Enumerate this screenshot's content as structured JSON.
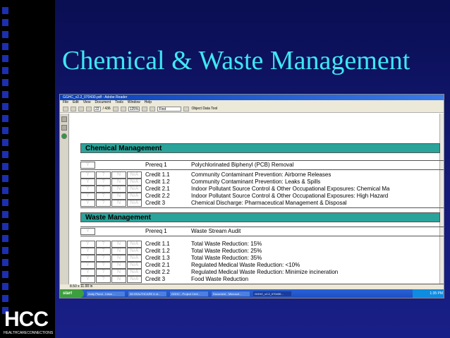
{
  "slide": {
    "title": "Chemical & Waste Management",
    "corner_glyph": "",
    "logo_text": "HCC",
    "logo_subtitle": "HEALTHCARECONNECTIONS"
  },
  "window": {
    "titlebar": "GGHC_v2.2_070430.pdf - Adobe Reader",
    "menu": [
      "File",
      "Edit",
      "View",
      "Document",
      "Tools",
      "Window",
      "Help"
    ],
    "page_current": "22",
    "page_total": "/ 436",
    "zoom": "125%",
    "find_placeholder": "Find",
    "object_data_tool": "Object Data Tool",
    "status_size": "8.50 x 11.00 in"
  },
  "sections": [
    {
      "header": "Chemical Management",
      "prereq": {
        "cell": "Y",
        "label": "Prereq 1",
        "desc": "Polychlorinated Biphenyl (PCB) Removal"
      },
      "credits": [
        {
          "label": "Credit 1.1",
          "desc": "Community Contaminant Prevention: Airborne Releases"
        },
        {
          "label": "Credit 1.2",
          "desc": "Community Contaminant Prevention: Leaks & Spills"
        },
        {
          "label": "Credit 2.1",
          "desc": "Indoor Pollutant Source Control & Other Occupational Exposures: Chemical Ma"
        },
        {
          "label": "Credit 2.2",
          "desc": "Indoor Pollutant Source Control & Other Occupational Exposures: High Hazard"
        },
        {
          "label": "Credit 3",
          "desc": "Chemical Discharge: Pharmaceutical Management & Disposal"
        }
      ]
    },
    {
      "header": "Waste Management",
      "prereq": {
        "cell": "Y",
        "label": "Prereq 1",
        "desc": "Waste Stream Audit"
      },
      "credits": [
        {
          "label": "Credit 1.1",
          "desc": "Total Waste Reduction: 15%"
        },
        {
          "label": "Credit 1.2",
          "desc": "Total Waste Reduction: 25%"
        },
        {
          "label": "Credit 1.3",
          "desc": "Total Waste Reduction: 35%"
        },
        {
          "label": "Credit 2.1",
          "desc": "Regulated Medical Waste Reduction: <10%"
        },
        {
          "label": "Credit 2.2",
          "desc": "Regulated Medical Waste Reduction: Minimize incineration"
        },
        {
          "label": "Credit 3",
          "desc": "Food Waste Reduction"
        }
      ]
    }
  ],
  "cell_labels": [
    "Y",
    "?",
    "N",
    "N/A"
  ],
  "taskbar": {
    "start": "start",
    "items": [
      "Andy Pfund - Inbox ...",
      "08 HEALTHCARE 6 of...",
      "GGHC - Project Certi...",
      "Document - Microsof...",
      "GGHC_v2.2_070430..."
    ],
    "clock": "1:35 PM"
  }
}
